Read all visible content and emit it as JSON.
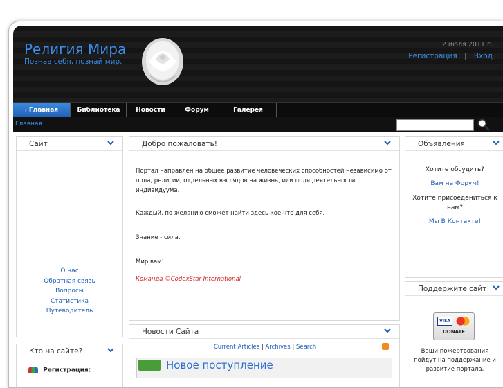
{
  "header": {
    "site_title": "Религия Мира",
    "site_slogan": "Познав себя, познай мир.",
    "date": "2 июля 2011 г.",
    "register_label": "Регистрация",
    "separator": "|",
    "login_label": "Вход"
  },
  "nav": {
    "items": [
      {
        "label": "Главная"
      },
      {
        "label": "Библиотека"
      },
      {
        "label": "Новости"
      },
      {
        "label": "Форум"
      },
      {
        "label": "Галерея"
      }
    ]
  },
  "breadcrumb": "Главная",
  "left": {
    "site_panel": {
      "title": "Сайт",
      "links": [
        "О нас",
        "Обратная связь",
        "Вопросы",
        "Статистика",
        "Путеводитель"
      ]
    },
    "who_panel": {
      "title": "Кто на сайте?",
      "item_label": "Регистрация:"
    }
  },
  "center": {
    "welcome": {
      "title": "Добро пожаловать!",
      "p1": "Портал направлен на общее развитие человеческих способностей независимо от пола, религии, отдельных взглядов на жизнь, или поля деятельности индивидуума.",
      "p2": "Каждый, по желанию сможет найти здесь кое-что для себя.",
      "p3": "Знание - сила.",
      "p4": "Мир вам!",
      "signature": "Команда ©CodexStar International"
    },
    "news": {
      "title": "Новости Сайта",
      "links": [
        "Current Articles",
        "Archives",
        "Search"
      ],
      "sep": "|",
      "headline": "Новое поступление"
    }
  },
  "right": {
    "ads": {
      "title": "Объявления",
      "q1": "Хотите обсудить?",
      "l1": "Вам на Форум!",
      "q2": "Хотите присоедениться к нам?",
      "l2": "Мы В Контакте!"
    },
    "support": {
      "title": "Поддержите сайт",
      "donate_label": "DONATE",
      "text": "Ваши пожертвования пойдут на поддержание и развитие портала."
    }
  },
  "colors": {
    "accent": "#3a8de8",
    "link": "#1f5fb8",
    "signature": "#d02020",
    "header_bg": "#151515"
  }
}
